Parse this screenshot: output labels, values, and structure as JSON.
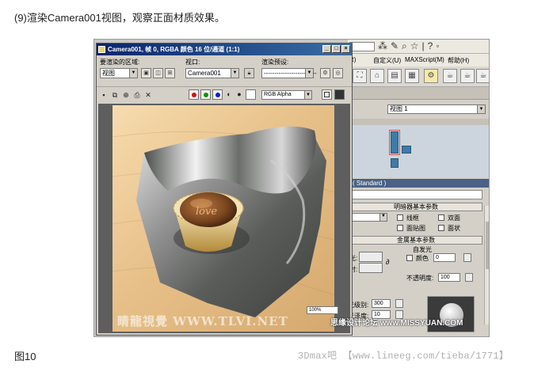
{
  "caption_top": "(9)渲染Camera001视图，观察正面材质效果。",
  "caption_bottom": "图10",
  "credit": "3Dmax吧 【www.lineeg.com/tieba/1771】",
  "site_watermark": "思缘设计论坛 www.MISSYUAN.COM",
  "render_window": {
    "title": "Camera001, 帧 0, RGBA 颜色 16 位/通道 (1:1)",
    "area_label": "要渲染的区域:",
    "area_value": "视图",
    "viewport_label": "视口:",
    "viewport_value": "Camera001",
    "preset_label": "渲染预设:",
    "preset_value": "-------------------------",
    "channel_value": "RGB Alpha",
    "image_watermark": "睛龍視覺 WWW.TLVI.NET",
    "chocolate_text": "love"
  },
  "max_ui": {
    "menu_items": [
      "R)",
      "自定义(U)",
      "MAXScript(M)",
      "帮助(H)"
    ],
    "viewport_select": "视图 1",
    "standard_label": "( Standard )",
    "shader_params_label": "明暗器基本参数",
    "wire_label": "线框",
    "twosided_label": "双面",
    "facemap_label": "面贴图",
    "faceted_label": "面状",
    "metal_params_label": "金属基本参数",
    "self_illum_label": "自发光",
    "color_label": "颜色",
    "self_illum_value": "0",
    "ambient_label": "光:",
    "diffuse_label": "射:",
    "opacity_label": "不透明度:",
    "opacity_value": "100",
    "spec_level_label": "光级别:",
    "spec_level_value": "300",
    "gloss_label": "光泽度:",
    "gloss_value": "10",
    "zoom_value": "100%"
  },
  "colors": {
    "title_bar": "#0a246a",
    "ui_gray": "#d4d0c8",
    "rollout_blue": "#4a6288",
    "schematic_node": "#3f7ba6"
  }
}
